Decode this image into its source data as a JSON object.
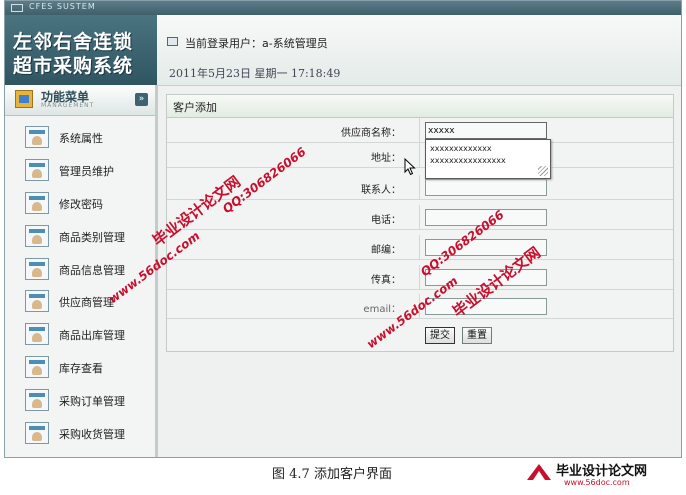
{
  "window": {
    "title": "CFES SUSTEM"
  },
  "logo": {
    "line1": "左邻右舍连锁",
    "line2": "超市采购系统"
  },
  "header": {
    "user_label": "当前登录用户：a-系统管理员",
    "datetime": "2011年5月23日  星期一  17:18:49"
  },
  "sidebar": {
    "title": "功能菜单",
    "subtitle": "MANAGEMENT",
    "collapse_glyph": "»",
    "items": [
      {
        "label": "系统属性"
      },
      {
        "label": "管理员维护"
      },
      {
        "label": "修改密码"
      },
      {
        "label": "商品类别管理"
      },
      {
        "label": "商品信息管理"
      },
      {
        "label": "供应商管理"
      },
      {
        "label": "商品出库管理"
      },
      {
        "label": "库存查看"
      },
      {
        "label": "采购订单管理"
      },
      {
        "label": "采购收货管理"
      }
    ]
  },
  "form": {
    "title": "客户添加",
    "fields": [
      {
        "label": "供应商名称：",
        "value": "xxxxx",
        "placeholder": ""
      },
      {
        "label": "地址：",
        "value": "",
        "placeholder": ""
      },
      {
        "label": "联系人：",
        "value": "",
        "placeholder": ""
      },
      {
        "label": "电话：",
        "value": "",
        "placeholder": ""
      },
      {
        "label": "邮编：",
        "value": "",
        "placeholder": ""
      },
      {
        "label": "传真：",
        "value": "",
        "placeholder": ""
      },
      {
        "label": "email：",
        "value": "",
        "placeholder": ""
      }
    ],
    "submit_label": "提交",
    "reset_label": "重置"
  },
  "autocomplete": {
    "options": [
      "xxxxxxxxxxxxx",
      "xxxxxxxxxxxxxxxx"
    ]
  },
  "watermarks": {
    "brand": "毕业设计论文网",
    "qq": "QQ:306826066",
    "url": "www.56doc.com"
  },
  "caption": "图 4.7 添加客户界面",
  "footer_logo": {
    "name": "毕业设计论文网",
    "url": "www.56doc.com"
  },
  "colors": {
    "watermark": "#c8102e",
    "logo_bg": "#3f6470",
    "frame_border": "#8aa0a8"
  }
}
